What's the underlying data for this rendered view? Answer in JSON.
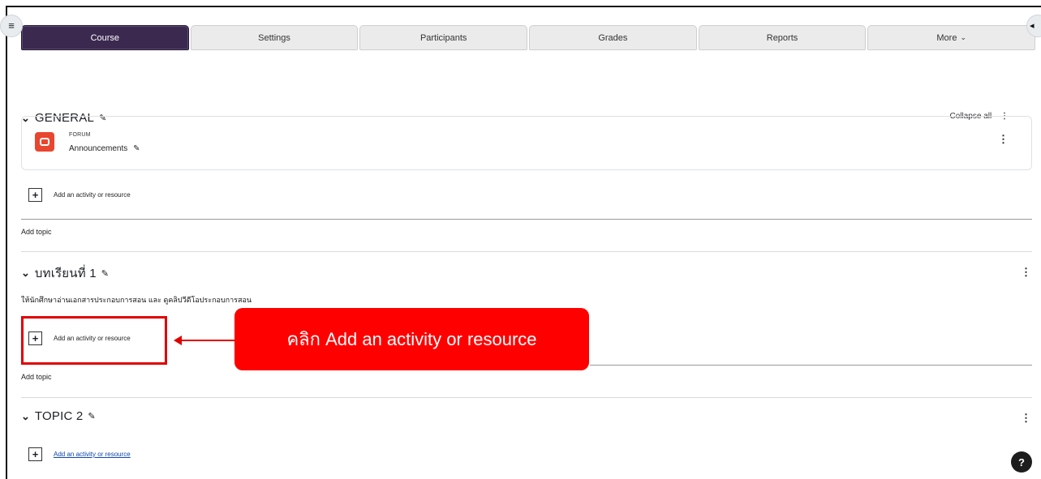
{
  "nav": {
    "tabs": [
      "Course",
      "Settings",
      "Participants",
      "Grades",
      "Reports",
      "More"
    ],
    "active_tab": "Course",
    "more_chevron": "⌄"
  },
  "header": {
    "drawer_icon": "≡",
    "right_drawer_icon": "◂",
    "collapse_all": "Collapse all"
  },
  "sections": {
    "general": {
      "title": "GENERAL",
      "activity": {
        "type": "FORUM",
        "name": "Announcements",
        "icon": "forum-icon"
      },
      "add_activity": "Add an activity or resource",
      "add_topic": "Add topic"
    },
    "lesson1": {
      "title": "บทเรียนที่ 1",
      "summary": "ให้นักศึกษาอ่านเอกสารประกอบการสอน และ ดูคลิปวีดีโอประกอบการสอน",
      "add_activity": "Add an activity or resource",
      "add_topic": "Add topic"
    },
    "topic2": {
      "title": "TOPIC 2",
      "add_activity": "Add an activity or resource"
    }
  },
  "annotation": {
    "callout": "คลิก Add an activity or resource",
    "color": "#ff0000"
  },
  "help": {
    "label": "?"
  },
  "colors": {
    "active_tab": "#3b2950",
    "forum_icon": "#e8462f",
    "link": "#0f47ad"
  }
}
